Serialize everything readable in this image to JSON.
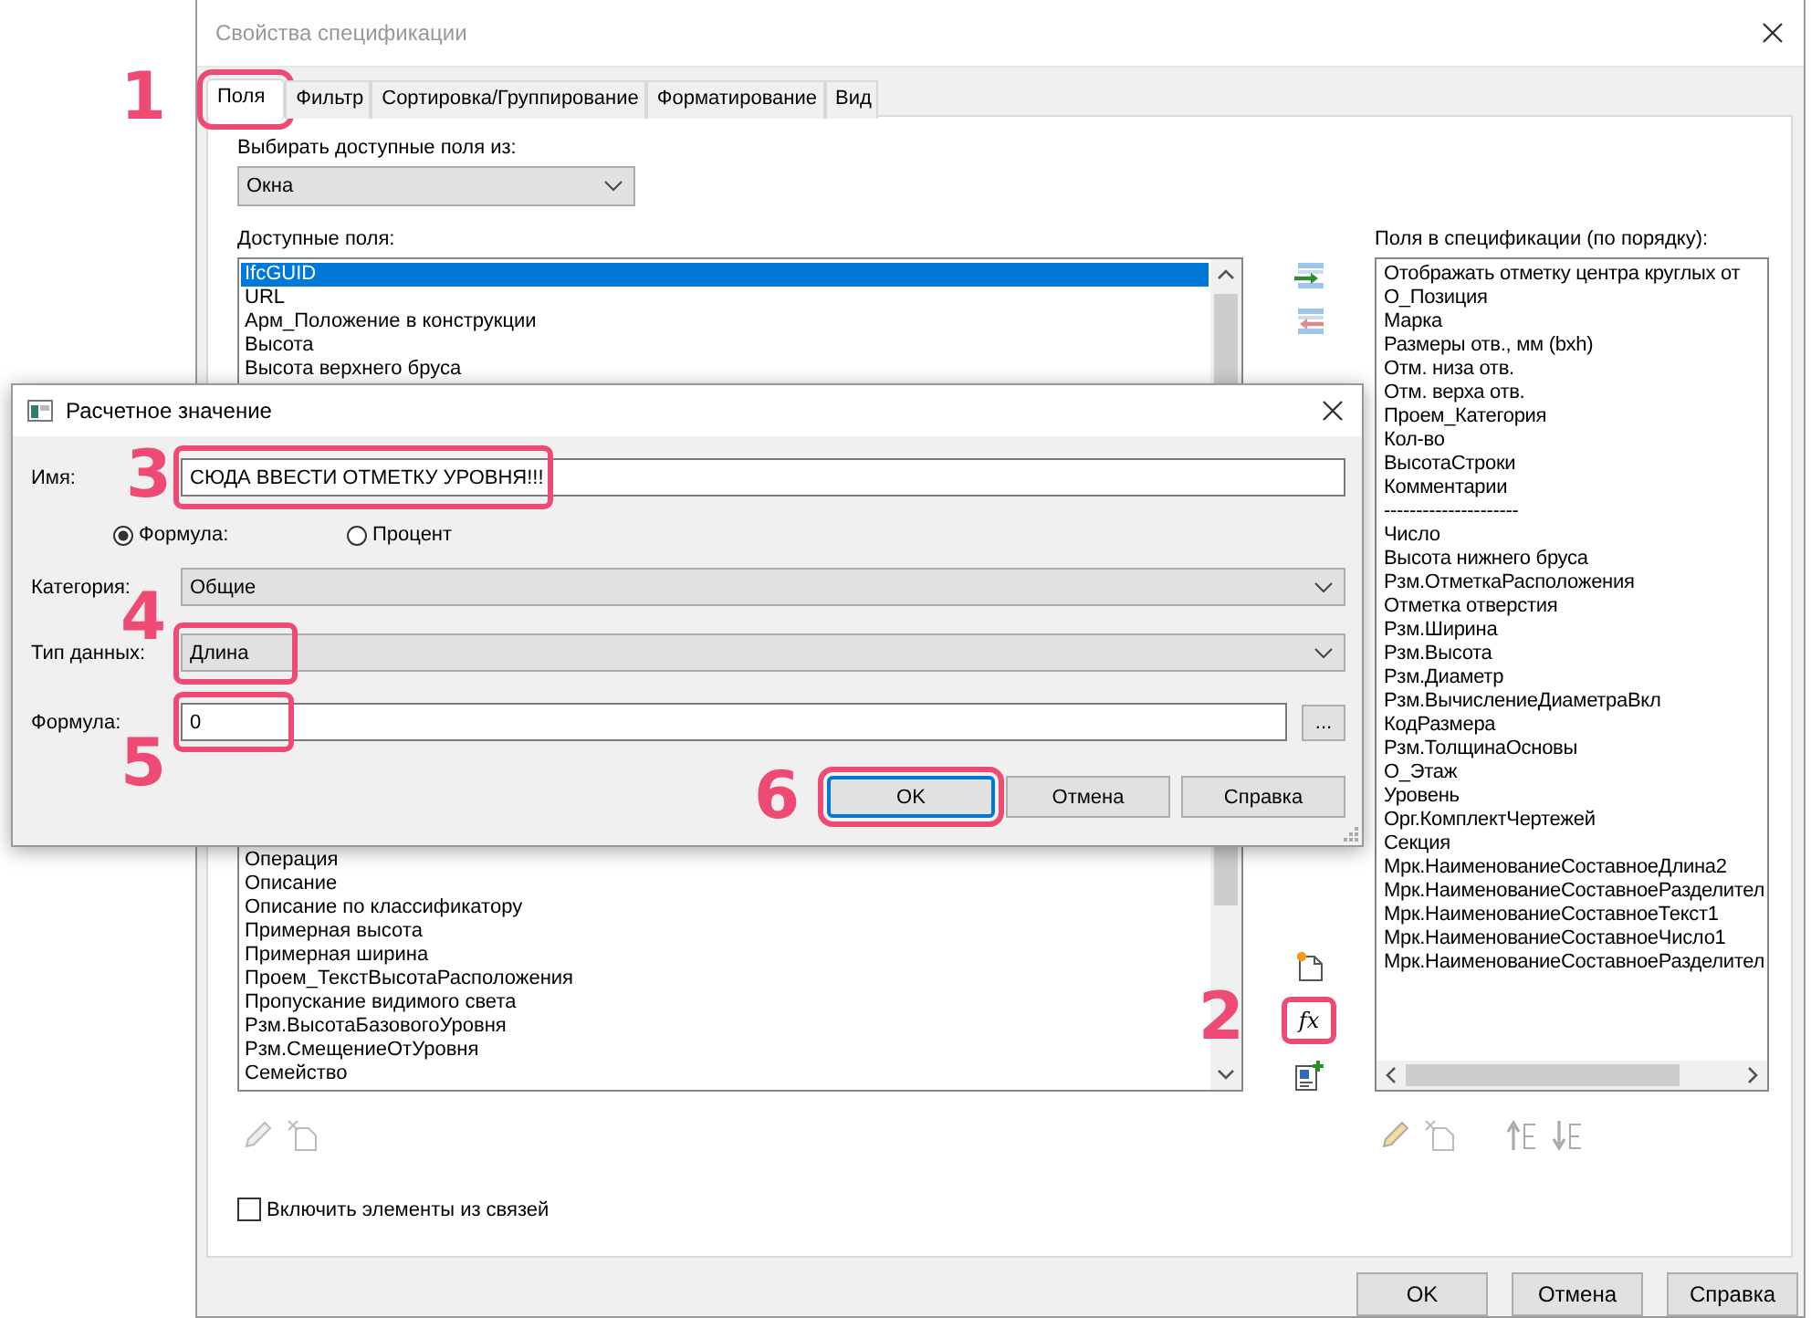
{
  "window": {
    "title": "Свойства спецификации"
  },
  "tabs": [
    {
      "label": "Поля",
      "selected": true,
      "highlighted": true,
      "callout": "1"
    },
    {
      "label": "Фильтр",
      "selected": false,
      "highlighted": false
    },
    {
      "label": "Сортировка/Группирование",
      "selected": false,
      "highlighted": false
    },
    {
      "label": "Форматирование",
      "selected": false,
      "highlighted": false
    },
    {
      "label": "Вид",
      "selected": false,
      "highlighted": false
    }
  ],
  "source": {
    "label": "Выбирать доступные поля из:",
    "value": "Окна"
  },
  "available": {
    "label": "Доступные поля:",
    "items_top": [
      {
        "text": "IfcGUID",
        "selected": true
      },
      {
        "text": "URL",
        "selected": false
      },
      {
        "text": "Арм_Положение в конструкции",
        "selected": false
      },
      {
        "text": "Высота",
        "selected": false
      },
      {
        "text": "Высота верхнего бруса",
        "selected": false
      }
    ],
    "items_bottom": [
      {
        "text": "Операция",
        "selected": false
      },
      {
        "text": "Описание",
        "selected": false
      },
      {
        "text": "Описание по классификатору",
        "selected": false
      },
      {
        "text": "Примерная высота",
        "selected": false
      },
      {
        "text": "Примерная ширина",
        "selected": false
      },
      {
        "text": "Проем_ТекстВысотаРасположения",
        "selected": false
      },
      {
        "text": "Пропускание видимого света",
        "selected": false
      },
      {
        "text": "Рзм.ВысотаБазовогоУровня",
        "selected": false
      },
      {
        "text": "Рзм.СмещениеОтУровня",
        "selected": false
      },
      {
        "text": "Семейство",
        "selected": false
      }
    ]
  },
  "formula_button": {
    "glyph": "fx",
    "highlighted": true,
    "callout": "2"
  },
  "scheduled": {
    "label": "Поля в спецификации (по порядку):",
    "items": [
      "Отображать отметку центра круглых от",
      "О_Позиция",
      "Марка",
      "Размеры отв., мм (bxh)",
      "Отм. низа отв.",
      "Отм. верха отв.",
      "Проем_Категория",
      "Кол-во",
      "ВысотаСтроки",
      "Комментарии",
      "---------------------",
      "Число",
      "Высота нижнего бруса",
      "Рзм.ОтметкаРасположения",
      "Отметка отверстия",
      "Рзм.Ширина",
      "Рзм.Высота",
      "Рзм.Диаметр",
      "Рзм.ВычислениеДиаметраВкл",
      "КодРазмера",
      "Рзм.ТолщинаОсновы",
      "О_Этаж",
      "Уровень",
      "Орг.КомплектЧертежей",
      "Секция",
      "Мрк.НаименованиеСоставноеДлина2",
      "Мрк.НаименованиеСоставноеРазделител",
      "Мрк.НаименованиеСоставноеТекст1",
      "Мрк.НаименованиеСоставноеЧисло1",
      "Мрк.НаименованиеСоставноеРазделител"
    ]
  },
  "include_links": {
    "label": "Включить элементы из связей",
    "checked": false
  },
  "buttons": [
    {
      "label": "OK"
    },
    {
      "label": "Отмена"
    },
    {
      "label": "Справка"
    }
  ],
  "dialog": {
    "title": "Расчетное значение",
    "name": {
      "label": "Имя:",
      "value": "СЮДА ВВЕСТИ ОТМЕТКУ УРОВНЯ!!!",
      "highlighted": true,
      "callout": "3"
    },
    "radios": [
      {
        "label": "Формула:",
        "selected": true
      },
      {
        "label": "Процент",
        "selected": false
      }
    ],
    "category": {
      "label": "Категория:",
      "value": "Общие"
    },
    "data_type": {
      "label": "Тип данных:",
      "value": "Длина",
      "highlighted": true,
      "callout": "4"
    },
    "formula": {
      "label": "Формула:",
      "value": "0",
      "highlighted": true,
      "callout": "5",
      "more": "..."
    },
    "buttons": [
      {
        "label": "OK",
        "default": true,
        "highlighted": true,
        "callout": "6"
      },
      {
        "label": "Отмена",
        "default": false,
        "highlighted": false
      },
      {
        "label": "Справка",
        "default": false,
        "highlighted": false
      }
    ]
  }
}
